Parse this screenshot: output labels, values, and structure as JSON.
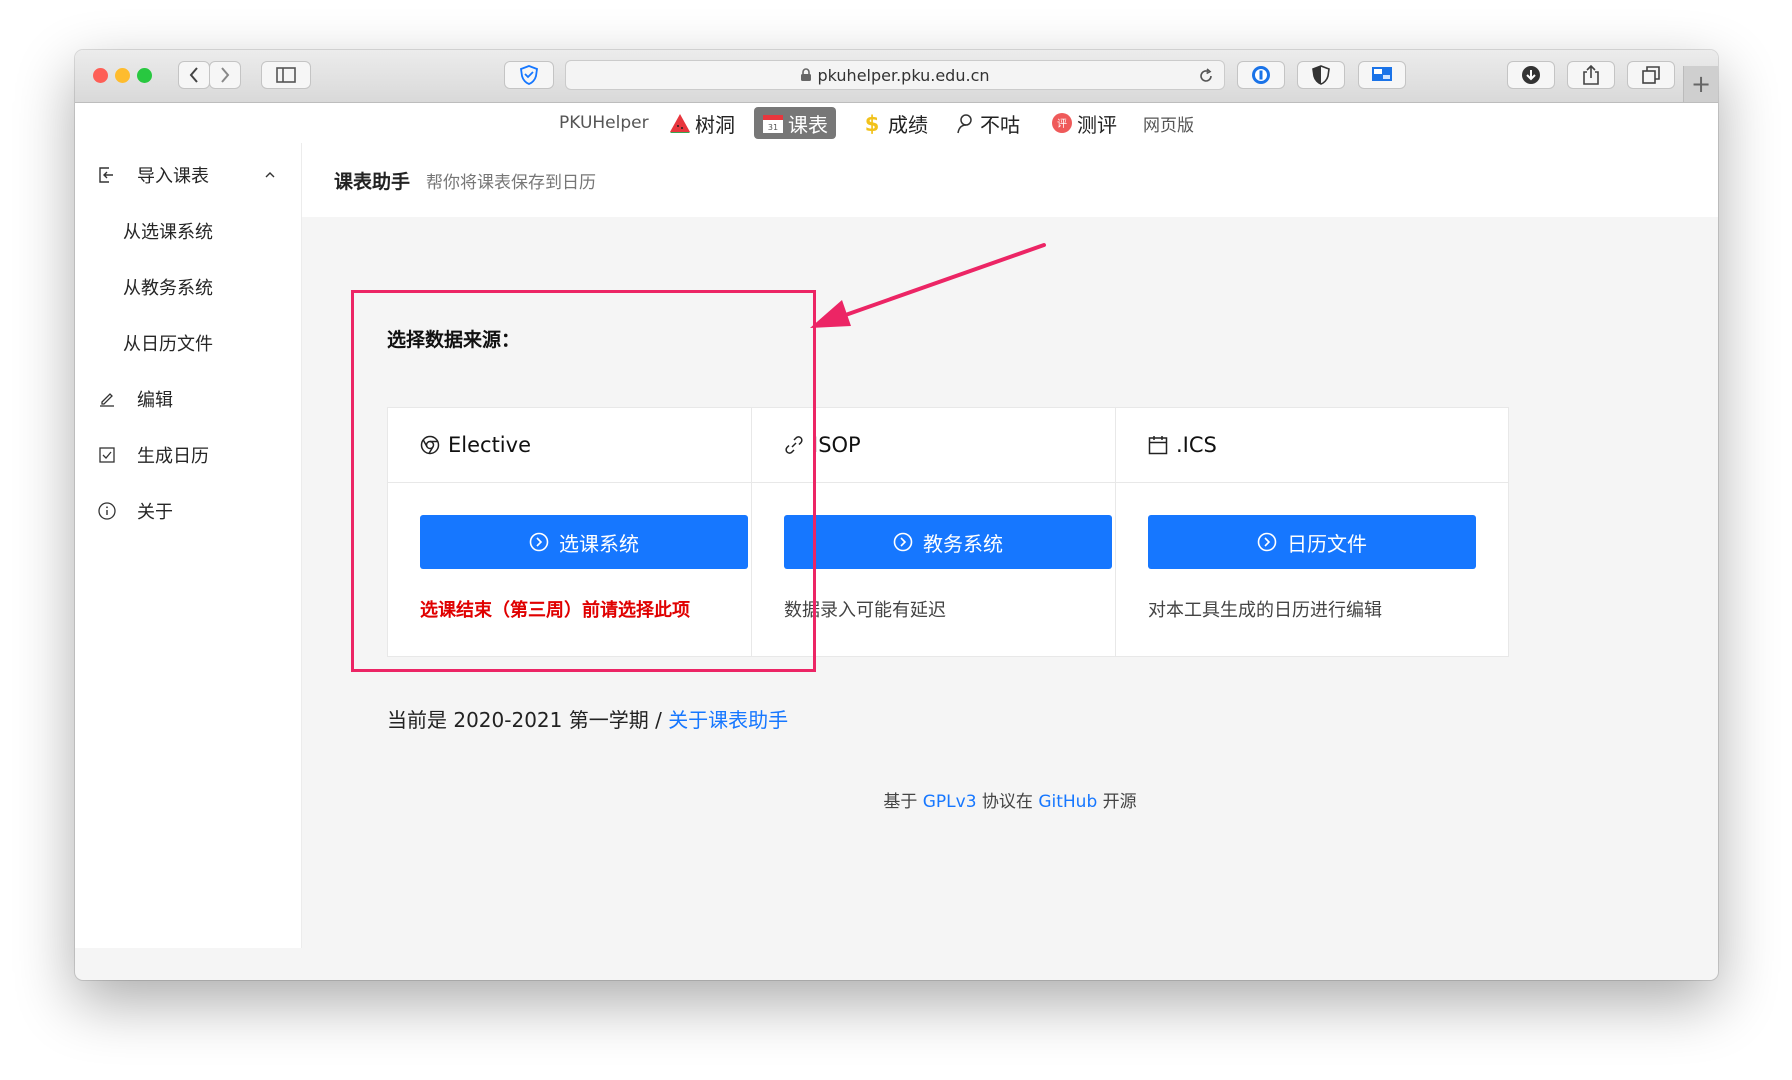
{
  "browser": {
    "url": "pkuhelper.pku.edu.cn",
    "new_tab_symbol": "+"
  },
  "site_nav": {
    "brand": "PKUHelper",
    "items": [
      {
        "label": "树洞",
        "icon": "watermelon-icon"
      },
      {
        "label": "课表",
        "icon": "calendar-icon",
        "active": true
      },
      {
        "label": "成绩",
        "icon": "dollar-icon"
      },
      {
        "label": "不咕",
        "icon": "person-icon"
      },
      {
        "label": "测评",
        "icon": "rating-icon"
      }
    ],
    "web_version": "网页版"
  },
  "sidebar": {
    "items": [
      {
        "label": "导入课表",
        "icon": "import-icon",
        "expanded": true
      },
      {
        "label": "从选课系统",
        "sub": true
      },
      {
        "label": "从教务系统",
        "sub": true
      },
      {
        "label": "从日历文件",
        "sub": true
      },
      {
        "label": "编辑",
        "icon": "edit-icon"
      },
      {
        "label": "生成日历",
        "icon": "check-square-icon"
      },
      {
        "label": "关于",
        "icon": "info-icon"
      }
    ]
  },
  "header": {
    "title": "课表助手",
    "subtitle": "帮你将课表保存到日历"
  },
  "main": {
    "source_title": "选择数据来源：",
    "cards": [
      {
        "title": "Elective",
        "icon": "chrome-icon",
        "button": "选课系统",
        "note": "选课结束（第三周）前请选择此项",
        "warn": true
      },
      {
        "title": "ISOP",
        "icon": "link-icon",
        "button": "教务系统",
        "note": "数据录入可能有延迟",
        "warn": false
      },
      {
        "title": ".ICS",
        "icon": "calendar-icon",
        "button": "日历文件",
        "note": "对本工具生成的日历进行编辑",
        "warn": false
      }
    ],
    "semester_text": "当前是 2020-2021 第一学期",
    "separator": " / ",
    "about_link": "关于课表助手"
  },
  "footer": {
    "prefix": "基于 ",
    "license": "GPLv3",
    "middle": " 协议在 ",
    "host": "GitHub",
    "suffix": " 开源"
  },
  "colors": {
    "accent": "#1677ff",
    "highlight": "#ec2565",
    "warning": "#e00000"
  }
}
